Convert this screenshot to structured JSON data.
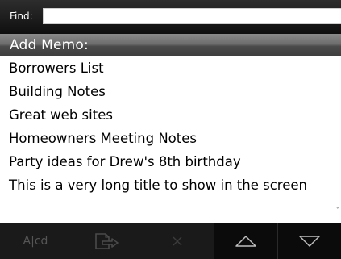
{
  "find": {
    "label": "Find:",
    "value": ""
  },
  "add_memo": {
    "label": "Add Memo:"
  },
  "memos": [
    "Borrowers List",
    "Building Notes",
    "Great web sites",
    "Homeowners Meeting Notes",
    "Party ideas for Drew's 8th birthday",
    "This is a very long title to show in the screen"
  ],
  "toolbar": {
    "text_button_label": "A|cd",
    "icons": [
      "export-icon",
      "close-icon",
      "up-arrow-icon",
      "down-arrow-icon"
    ]
  },
  "colors": {
    "header_bg": "#1e1e1e",
    "add_memo_bg": "#5a5a5a",
    "toolbar_bg": "#161616",
    "disabled_icon": "#4a4a4a",
    "active_icon": "#bfbfbf"
  }
}
